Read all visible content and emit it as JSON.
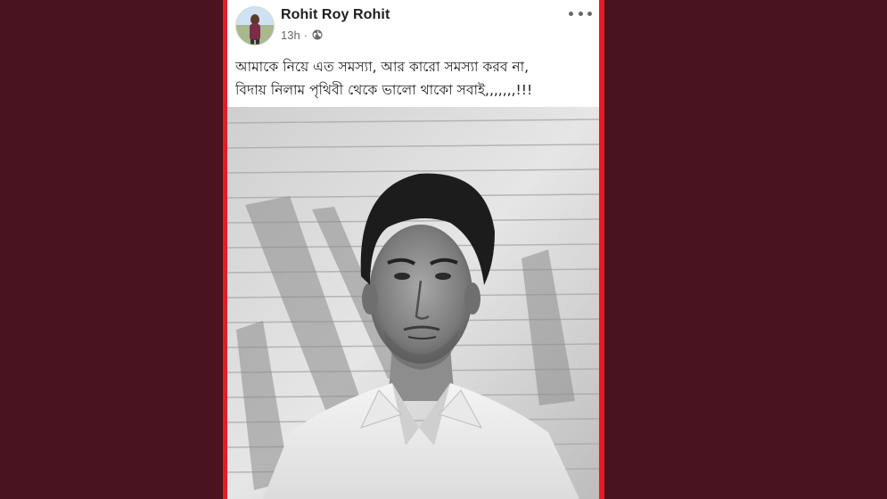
{
  "post": {
    "author_name": "Rohit Roy Rohit",
    "time": "13h",
    "separator": "·",
    "privacy_icon": "globe-icon",
    "more_icon": "more-options-icon",
    "text_lines": [
      "আমাকে নিয়ে এত সমস্যা, আর কারো সমস্যা করব না,",
      "বিদায় নিলাম পৃথিবী থেকে ভালো থাকো সবাই,,,,,,,!!!"
    ],
    "photo": {
      "style": "black-and-white",
      "subject": "man in white shirt"
    }
  },
  "colors": {
    "background": "#4a1320",
    "frame_border": "#e01e26",
    "card": "#ffffff",
    "name_text": "#1c1e21",
    "meta_text": "#65676b"
  }
}
